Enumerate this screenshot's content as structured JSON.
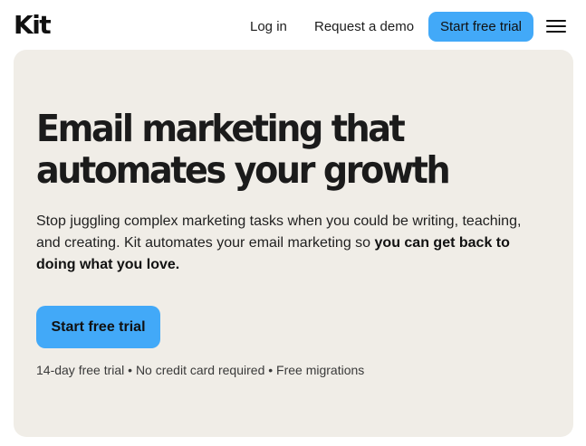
{
  "header": {
    "logo_text": "Kit",
    "login_label": "Log in",
    "demo_label": "Request a demo",
    "cta_label": "Start free trial",
    "menu_icon": "hamburger-menu-icon"
  },
  "hero": {
    "headline_line1": "Email marketing that",
    "headline_line2": "automates your growth",
    "subtext_regular": "Stop juggling complex marketing tasks when you could be writing, teaching, and creating. Kit automates your email marketing so ",
    "subtext_bold": "you can get back to doing what you love.",
    "cta_label": "Start free trial",
    "fineprint": "14-day free trial • No credit card required • Free migrations"
  },
  "colors": {
    "accent": "#42a9f8",
    "hero_background": "#f0ede7",
    "text": "#1b1b1b"
  }
}
